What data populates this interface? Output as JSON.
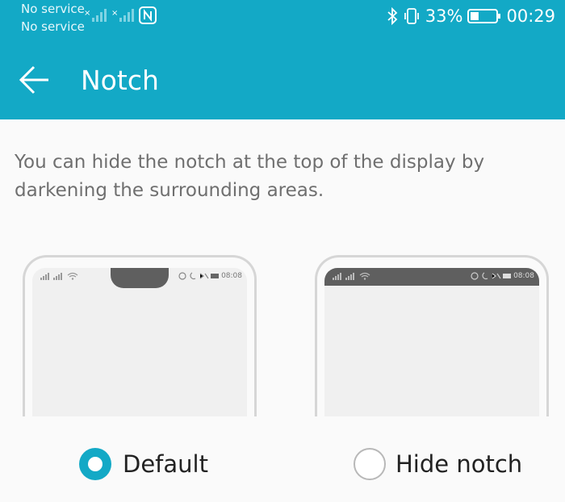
{
  "status_bar": {
    "sim1": "No service",
    "sim2": "No service",
    "battery_percent": "33%",
    "battery_level": 0.33,
    "time": "00:29",
    "icons": [
      "bluetooth-icon",
      "vibrate-icon",
      "battery-icon",
      "nfc-icon",
      "signal-icon"
    ]
  },
  "header": {
    "title": "Notch",
    "back_icon": "back-arrow-icon"
  },
  "description": "You can hide the notch at the top of the display by darkening the surrounding areas.",
  "preview": {
    "time": "08:08"
  },
  "options": [
    {
      "label": "Default",
      "selected": true
    },
    {
      "label": "Hide notch",
      "selected": false
    }
  ],
  "colors": {
    "accent": "#13a9c6",
    "notch": "#5f5f5f",
    "text": "#222222",
    "secondary_text": "#6f6f6f"
  }
}
